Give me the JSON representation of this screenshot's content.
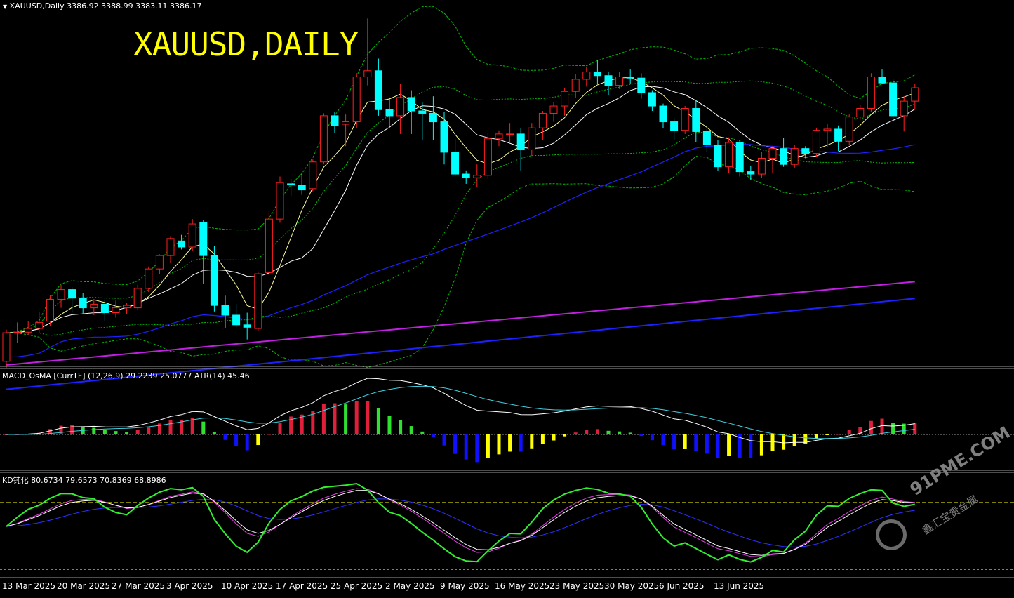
{
  "header": {
    "symbol_line": "XAUUSD,Daily  3386.92 3388.99 3383.11 3386.17",
    "big_title": "XAUUSD,DAILY"
  },
  "macd_panel": {
    "label": "MACD_OsMA [CurrTF] (12,26,9) 29.2239 25.0777  ATR(14) 45.46"
  },
  "kd_panel": {
    "label": "KD钝化 80.6734 79.6573 70.8369 68.8986"
  },
  "watermark": {
    "brand": "91PME.COM",
    "sub": "鑫汇宝贵金属"
  },
  "colors": {
    "background": "#000000",
    "bull_body": "#000000",
    "bull_outline": "#ff2020",
    "bear_body": "#00ffff",
    "ma_short": "#ffff99",
    "ma_mid": "#ffffff",
    "bollinger": "#00c000",
    "ma_long1": "#2020ff",
    "ma_long2": "#c020e0",
    "hist_red": "#e0203a",
    "hist_green": "#30e030",
    "hist_blue": "#1010ff",
    "hist_yellow": "#ffff00",
    "kd_green": "#30f030",
    "kd_white": "#ffffff",
    "kd_magenta": "#e040e0",
    "kd_blue": "#3030ff",
    "kd_level": "#ffff00"
  },
  "chart_data": {
    "type": "candlestick",
    "instrument": "XAUUSD",
    "timeframe": "Daily",
    "last_ohlc": {
      "open": 3386.92,
      "high": 3388.99,
      "low": 3383.11,
      "close": 3386.17
    },
    "x_tick_labels": [
      "13 Mar 2025",
      "20 Mar 2025",
      "27 Mar 2025",
      "3 Apr 2025",
      "10 Apr 2025",
      "17 Apr 2025",
      "25 Apr 2025",
      "2 May 2025",
      "9 May 2025",
      "16 May 2025",
      "23 May 2025",
      "30 May 2025",
      "6 Jun 2025",
      "13 Jun 2025"
    ],
    "x_tick_index": [
      0,
      5,
      10,
      15,
      20,
      25,
      30,
      35,
      40,
      45,
      50,
      55,
      60,
      65
    ],
    "candles": [
      [
        2936,
        2988,
        2925,
        2983
      ],
      [
        2984,
        3000,
        2966,
        2984
      ],
      [
        2984,
        3002,
        2980,
        2990
      ],
      [
        2990,
        3018,
        2982,
        3000
      ],
      [
        3002,
        3045,
        2994,
        3038
      ],
      [
        3038,
        3062,
        3024,
        3054
      ],
      [
        3054,
        3058,
        3016,
        3040
      ],
      [
        3040,
        3048,
        3014,
        3024
      ],
      [
        3024,
        3036,
        3012,
        3030
      ],
      [
        3030,
        3038,
        3002,
        3016
      ],
      [
        3016,
        3036,
        3008,
        3024
      ],
      [
        3024,
        3032,
        3014,
        3028
      ],
      [
        3024,
        3062,
        3020,
        3056
      ],
      [
        3056,
        3092,
        3050,
        3088
      ],
      [
        3088,
        3112,
        3080,
        3110
      ],
      [
        3110,
        3142,
        3098,
        3138
      ],
      [
        3134,
        3144,
        3120,
        3124
      ],
      [
        3124,
        3170,
        3118,
        3162
      ],
      [
        3164,
        3168,
        3064,
        3110
      ],
      [
        3110,
        3126,
        3018,
        3028
      ],
      [
        3028,
        3044,
        2990,
        3012
      ],
      [
        3012,
        3030,
        2992,
        2996
      ],
      [
        2996,
        3016,
        2972,
        2992
      ],
      [
        2990,
        3084,
        2986,
        3080
      ],
      [
        3082,
        3184,
        3078,
        3170
      ],
      [
        3170,
        3240,
        3164,
        3230
      ],
      [
        3228,
        3236,
        3208,
        3226
      ],
      [
        3226,
        3244,
        3210,
        3218
      ],
      [
        3220,
        3268,
        3216,
        3264
      ],
      [
        3264,
        3344,
        3260,
        3340
      ],
      [
        3340,
        3346,
        3312,
        3324
      ],
      [
        3326,
        3342,
        3290,
        3330
      ],
      [
        3330,
        3410,
        3320,
        3404
      ],
      [
        3404,
        3500,
        3390,
        3414
      ],
      [
        3414,
        3434,
        3340,
        3350
      ],
      [
        3350,
        3370,
        3320,
        3340
      ],
      [
        3340,
        3392,
        3310,
        3370
      ],
      [
        3370,
        3382,
        3310,
        3348
      ],
      [
        3348,
        3362,
        3300,
        3344
      ],
      [
        3344,
        3372,
        3300,
        3330
      ],
      [
        3330,
        3346,
        3260,
        3280
      ],
      [
        3280,
        3302,
        3240,
        3244
      ],
      [
        3244,
        3250,
        3228,
        3238
      ],
      [
        3238,
        3260,
        3222,
        3242
      ],
      [
        3242,
        3312,
        3236,
        3302
      ],
      [
        3302,
        3316,
        3290,
        3310
      ],
      [
        3310,
        3328,
        3296,
        3310
      ],
      [
        3310,
        3320,
        3250,
        3284
      ],
      [
        3284,
        3328,
        3274,
        3320
      ],
      [
        3320,
        3348,
        3300,
        3344
      ],
      [
        3344,
        3362,
        3330,
        3356
      ],
      [
        3356,
        3386,
        3340,
        3380
      ],
      [
        3380,
        3408,
        3370,
        3400
      ],
      [
        3400,
        3420,
        3388,
        3412
      ],
      [
        3412,
        3432,
        3392,
        3406
      ],
      [
        3406,
        3412,
        3374,
        3390
      ],
      [
        3390,
        3412,
        3384,
        3404
      ],
      [
        3404,
        3416,
        3392,
        3402
      ],
      [
        3402,
        3410,
        3368,
        3378
      ],
      [
        3378,
        3382,
        3348,
        3356
      ],
      [
        3356,
        3360,
        3320,
        3330
      ],
      [
        3330,
        3336,
        3300,
        3316
      ],
      [
        3316,
        3356,
        3310,
        3352
      ],
      [
        3352,
        3366,
        3296,
        3314
      ],
      [
        3314,
        3318,
        3280,
        3292
      ],
      [
        3292,
        3300,
        3250,
        3256
      ],
      [
        3256,
        3304,
        3246,
        3296
      ],
      [
        3296,
        3300,
        3240,
        3248
      ],
      [
        3248,
        3258,
        3234,
        3244
      ],
      [
        3244,
        3280,
        3238,
        3270
      ],
      [
        3270,
        3290,
        3246,
        3286
      ],
      [
        3286,
        3304,
        3256,
        3260
      ],
      [
        3260,
        3292,
        3254,
        3286
      ],
      [
        3286,
        3290,
        3270,
        3278
      ],
      [
        3278,
        3320,
        3272,
        3316
      ],
      [
        3316,
        3326,
        3288,
        3318
      ],
      [
        3318,
        3324,
        3282,
        3298
      ],
      [
        3298,
        3342,
        3292,
        3338
      ],
      [
        3338,
        3358,
        3334,
        3352
      ],
      [
        3352,
        3410,
        3346,
        3404
      ],
      [
        3404,
        3416,
        3392,
        3394
      ],
      [
        3394,
        3400,
        3330,
        3340
      ],
      [
        3340,
        3372,
        3314,
        3364
      ],
      [
        3364,
        3392,
        3350,
        3386
      ]
    ],
    "y_range": [
      2930,
      3505
    ]
  }
}
